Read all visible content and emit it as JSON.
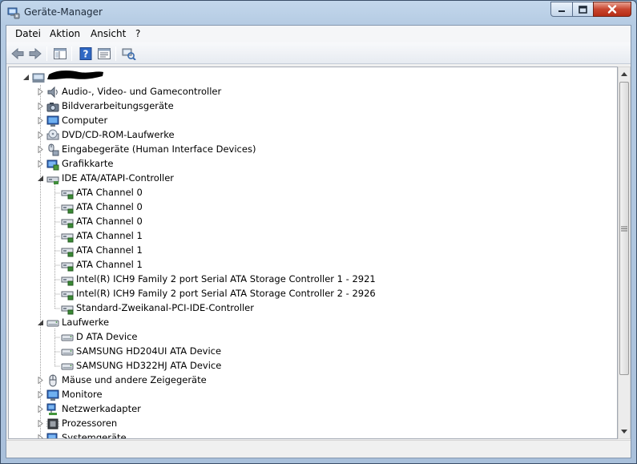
{
  "window": {
    "title": "Geräte-Manager"
  },
  "menu": [
    {
      "label": "Datei",
      "key": "menu-datei"
    },
    {
      "label": "Aktion",
      "key": "menu-aktion"
    },
    {
      "label": "Ansicht",
      "key": "menu-ansicht"
    },
    {
      "label": "?",
      "key": "menu-help"
    }
  ],
  "toolbar": [
    {
      "name": "back-icon"
    },
    {
      "name": "forward-icon"
    },
    {
      "name": "show-hide-console-tree-icon"
    },
    {
      "name": "help-icon"
    },
    {
      "name": "properties-icon"
    },
    {
      "name": "scan-hardware-icon"
    }
  ],
  "tree": [
    {
      "level": 0,
      "label": "",
      "icon": "computer-root-icon",
      "expander": "expanded"
    },
    {
      "level": 1,
      "label": "Audio-, Video- und Gamecontroller",
      "icon": "speaker-icon",
      "expander": "collapsed"
    },
    {
      "level": 1,
      "label": "Bildverarbeitungsgeräte",
      "icon": "camera-icon",
      "expander": "collapsed"
    },
    {
      "level": 1,
      "label": "Computer",
      "icon": "monitor-icon",
      "expander": "collapsed"
    },
    {
      "level": 1,
      "label": "DVD/CD-ROM-Laufwerke",
      "icon": "dvd-drive-icon",
      "expander": "collapsed"
    },
    {
      "level": 1,
      "label": "Eingabegeräte (Human Interface Devices)",
      "icon": "input-device-icon",
      "expander": "collapsed"
    },
    {
      "level": 1,
      "label": "Grafikkarte",
      "icon": "display-adapter-icon",
      "expander": "collapsed"
    },
    {
      "level": 1,
      "label": "IDE ATA/ATAPI-Controller",
      "icon": "ide-controller-icon",
      "expander": "expanded"
    },
    {
      "level": 2,
      "label": "ATA Channel 0",
      "icon": "ide-channel-icon"
    },
    {
      "level": 2,
      "label": "ATA Channel 0",
      "icon": "ide-channel-icon"
    },
    {
      "level": 2,
      "label": "ATA Channel 0",
      "icon": "ide-channel-icon"
    },
    {
      "level": 2,
      "label": "ATA Channel 1",
      "icon": "ide-channel-icon"
    },
    {
      "level": 2,
      "label": "ATA Channel 1",
      "icon": "ide-channel-icon"
    },
    {
      "level": 2,
      "label": "ATA Channel 1",
      "icon": "ide-channel-icon"
    },
    {
      "level": 2,
      "label": "Intel(R) ICH9 Family 2 port Serial ATA Storage Controller 1 - 2921",
      "icon": "ide-channel-icon"
    },
    {
      "level": 2,
      "label": "Intel(R) ICH9 Family 2 port Serial ATA Storage Controller 2 - 2926",
      "icon": "ide-channel-icon"
    },
    {
      "level": 2,
      "label": "Standard-Zweikanal-PCI-IDE-Controller",
      "icon": "ide-channel-icon"
    },
    {
      "level": 1,
      "label": "Laufwerke",
      "icon": "disk-drive-icon",
      "expander": "expanded"
    },
    {
      "level": 2,
      "label": " D ATA Device",
      "icon": "disk-drive-icon"
    },
    {
      "level": 2,
      "label": "SAMSUNG HD204UI ATA Device",
      "icon": "disk-drive-icon"
    },
    {
      "level": 2,
      "label": "SAMSUNG HD322HJ ATA Device",
      "icon": "disk-drive-icon"
    },
    {
      "level": 1,
      "label": "Mäuse und andere Zeigegeräte",
      "icon": "mouse-icon",
      "expander": "collapsed"
    },
    {
      "level": 1,
      "label": "Monitore",
      "icon": "monitor-icon",
      "expander": "collapsed"
    },
    {
      "level": 1,
      "label": "Netzwerkadapter",
      "icon": "network-adapter-icon",
      "expander": "collapsed"
    },
    {
      "level": 1,
      "label": "Prozessoren",
      "icon": "processor-icon",
      "expander": "collapsed"
    },
    {
      "level": 1,
      "label": "Systemgeräte",
      "icon": "system-device-icon",
      "expander": "collapsed"
    }
  ],
  "colors": {
    "titlebar": "#c3d7ec",
    "close_button": "#c8452f",
    "tree_background": "#ffffff"
  }
}
